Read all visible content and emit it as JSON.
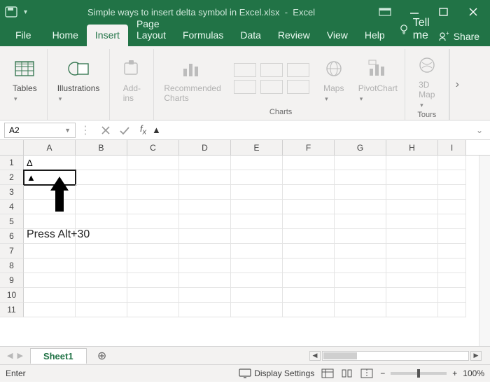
{
  "title": {
    "filename": "Simple ways to insert delta symbol in Excel.xlsx",
    "appname": "Excel"
  },
  "menubar": {
    "file": "File",
    "home": "Home",
    "insert": "Insert",
    "pagelayout": "Page Layout",
    "formulas": "Formulas",
    "data": "Data",
    "review": "Review",
    "view": "View",
    "help": "Help",
    "tellme": "Tell me",
    "share": "Share"
  },
  "ribbon": {
    "tables": "Tables",
    "illustrations": "Illustrations",
    "addins": "Add-\nins",
    "recommended": "Recommended\nCharts",
    "maps": "Maps",
    "pivotchart": "PivotChart",
    "map3d": "3D\nMap",
    "group_charts": "Charts",
    "group_tours": "Tours"
  },
  "namebox": "A2",
  "formula": "▲",
  "columns": [
    "A",
    "B",
    "C",
    "D",
    "E",
    "F",
    "G",
    "H",
    "I"
  ],
  "rows": [
    "1",
    "2",
    "3",
    "4",
    "5",
    "6",
    "7",
    "8",
    "9",
    "10",
    "11"
  ],
  "cells": {
    "A1": "Δ",
    "A2": "▲"
  },
  "annotation": "Press Alt+30",
  "sheets": {
    "active": "Sheet1"
  },
  "status": {
    "mode": "Enter",
    "display": "Display Settings",
    "zoom_minus": "−",
    "zoom_plus": "+",
    "zoom_value": "100%"
  }
}
